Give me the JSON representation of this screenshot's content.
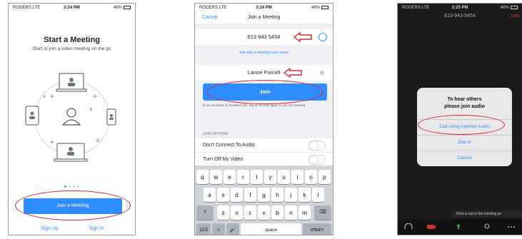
{
  "phone1": {
    "status": {
      "carrier": "ROGERS  LTE",
      "time": "3:24 PM",
      "battery": "46%"
    },
    "title": "Start a Meeting",
    "subtitle": "Start or join a video meeting on the go",
    "join_button": "Join a Meeting",
    "sign_up": "Sign Up",
    "sign_in": "Sign In"
  },
  "phone2": {
    "status": {
      "carrier": "ROGERS  LTE",
      "time": "3:24 PM",
      "battery": "46%"
    },
    "nav": {
      "cancel": "Cancel",
      "title": "Join a Meeting"
    },
    "meeting_id": "613 943 5454",
    "room_link": "Join with a meeting room name",
    "name": "Lance Purcell",
    "join_button": "Join",
    "hint": "If you received an invitation link, tap on the link again to join the meeting.",
    "options_header": "JOIN OPTIONS",
    "options": [
      "Don't Connect To Audio",
      "Turn Off My Video"
    ],
    "keyboard": {
      "row1": [
        "q",
        "w",
        "e",
        "r",
        "t",
        "y",
        "u",
        "i",
        "o",
        "p"
      ],
      "row2": [
        "a",
        "s",
        "d",
        "f",
        "g",
        "h",
        "j",
        "k",
        "l"
      ],
      "row3": [
        "z",
        "x",
        "c",
        "v",
        "b",
        "n",
        "m"
      ],
      "num_key": "123",
      "space_key": "space",
      "return_key": "return"
    }
  },
  "phone3": {
    "status": {
      "carrier": "ROGERS  LTE",
      "time": "3:25 PM",
      "battery": "46%"
    },
    "meeting_number": "613-943-5454",
    "leave": "Lea",
    "dialog": {
      "title_line1": "To hear others",
      "title_line2": "please join audio",
      "internet_audio": "Call using Internet Audio",
      "dial_in": "Dial in",
      "cancel": "Cancel"
    },
    "toast": "Host is not in the meeting ye"
  },
  "colors": {
    "accent": "#2d8cff",
    "annotation": "#e0202a"
  }
}
